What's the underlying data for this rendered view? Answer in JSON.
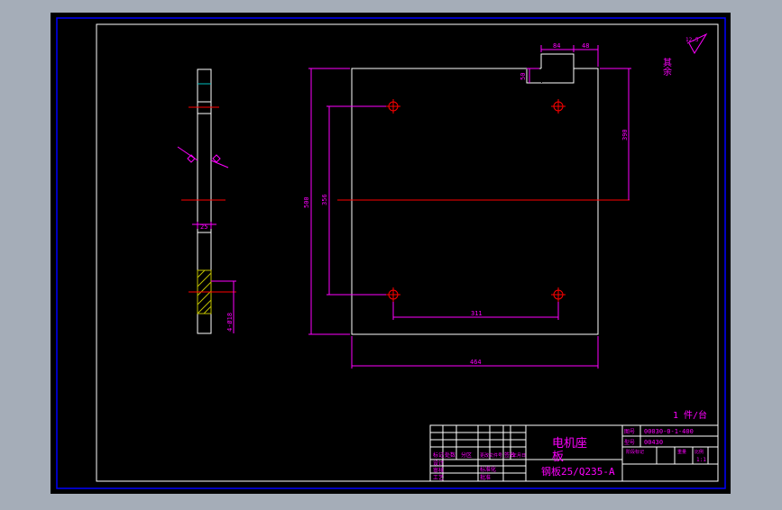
{
  "colors": {
    "background_gray": "#a5adb8",
    "paper": "#000000",
    "frame": "#0000ff",
    "border": "#ffffff",
    "dimension": "#ff00ff",
    "centerline": "#ff0000",
    "hatch": "#c0c000"
  },
  "roughness_note": {
    "label": "其余",
    "value": "12.5"
  },
  "dimensions": {
    "notch_width": "84",
    "notch_offset": "48",
    "notch_depth": "50",
    "hole_spacing_vertical_right": "390",
    "overall_height": "500",
    "hole_spacing_vertical_left": "356",
    "hole_spacing_horizontal": "311",
    "overall_width": "464",
    "side_thickness": "25",
    "holes": "4-Ø18"
  },
  "quantity_note": "1 件/台",
  "title_block": {
    "part_name": "电机座",
    "part_name_cont": "板",
    "material": "钢板25/Q235-A",
    "drawing_no": "00030-0-1-400",
    "drawing_no_label": "图号",
    "model": "00430",
    "model_label": "型号",
    "row_labels": [
      "标记",
      "设计",
      "审核",
      "工艺"
    ],
    "col_labels": [
      "处数",
      "分区",
      "更改文件号",
      "签名",
      "年月日"
    ],
    "sub_labels": [
      "标准化",
      "批准"
    ],
    "stage_labels": [
      "阶段标记",
      "重量",
      "比例"
    ],
    "scale": "1:1"
  }
}
